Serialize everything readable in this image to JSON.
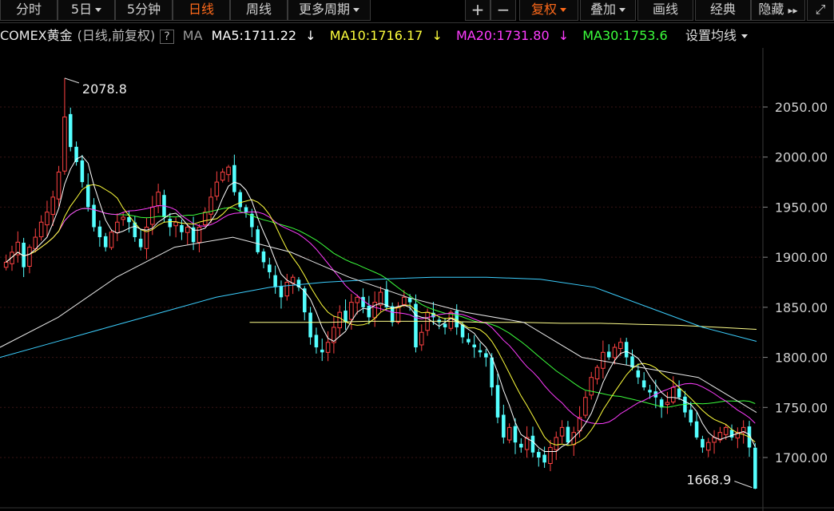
{
  "toolbar": {
    "tabs": [
      {
        "label": "分时"
      },
      {
        "label": "5日"
      },
      {
        "label": "5分钟"
      },
      {
        "label": "日线"
      },
      {
        "label": "周线"
      },
      {
        "label": "更多周期"
      }
    ],
    "right_buttons": [
      {
        "label": "+"
      },
      {
        "label": "−"
      },
      {
        "label": "复权"
      },
      {
        "label": "叠加"
      },
      {
        "label": "画线"
      },
      {
        "label": "经典"
      },
      {
        "label": "隐藏"
      }
    ],
    "active_tab": "日线"
  },
  "info": {
    "symbol": "COMEX黄金",
    "mode": "(日线,前复权)",
    "help": "?",
    "ma_label": "MA",
    "ma5": "MA5:1711.22",
    "ma10": "MA10:1716.17",
    "ma20": "MA20:1731.80",
    "ma30": "MA30:1753.6",
    "settings": "设置均线"
  },
  "colors": {
    "up": "#ff4242",
    "down": "#54ffff",
    "ma5": "#ffffff",
    "ma10": "#ffff3c",
    "ma20": "#ff3cff",
    "ma30": "#3cff3c",
    "ma60": "#e8e8e8",
    "ma120": "#3ccfff",
    "ma250": "#ffff8c",
    "active": "#ff6a1a"
  },
  "chart_data": {
    "type": "candlestick",
    "y_axis": {
      "ticks": [
        "2050.00",
        "2000.00",
        "1950.00",
        "1900.00",
        "1850.00",
        "1800.00",
        "1750.00",
        "1700.00"
      ],
      "range": [
        1665,
        2090
      ]
    },
    "annotations": {
      "high": "2078.8",
      "low": "1668.9"
    },
    "closes": [
      1895,
      1905,
      1915,
      1890,
      1910,
      1920,
      1935,
      1945,
      1960,
      1985,
      2040,
      2010,
      1995,
      1975,
      1950,
      1930,
      1920,
      1910,
      1925,
      1935,
      1940,
      1935,
      1920,
      1910,
      1930,
      1950,
      1965,
      1940,
      1930,
      1935,
      1925,
      1930,
      1915,
      1930,
      1945,
      1960,
      1975,
      1985,
      1990,
      1965,
      1950,
      1945,
      1930,
      1905,
      1895,
      1885,
      1870,
      1860,
      1875,
      1880,
      1870,
      1845,
      1820,
      1810,
      1805,
      1815,
      1830,
      1845,
      1835,
      1855,
      1860,
      1850,
      1840,
      1855,
      1865,
      1850,
      1835,
      1850,
      1860,
      1855,
      1810,
      1825,
      1845,
      1840,
      1835,
      1830,
      1845,
      1830,
      1820,
      1815,
      1810,
      1805,
      1800,
      1770,
      1740,
      1720,
      1730,
      1715,
      1710,
      1720,
      1705,
      1700,
      1695,
      1710,
      1720,
      1730,
      1715,
      1725,
      1740,
      1760,
      1780,
      1790,
      1805,
      1800,
      1810,
      1815,
      1800,
      1790,
      1780,
      1770,
      1765,
      1760,
      1750,
      1755,
      1770,
      1760,
      1745,
      1735,
      1720,
      1710,
      1715,
      1720,
      1725,
      1730,
      1720,
      1725,
      1730,
      1710,
      1669
    ],
    "ma_lines": [
      {
        "name": "MA250",
        "values": [
          1835,
          1835,
          1835,
          1836,
          1836,
          1836,
          1835,
          1835,
          1834,
          1834,
          1833,
          1832,
          1830,
          1828
        ]
      },
      {
        "name": "MA120",
        "values": [
          1800,
          1815,
          1830,
          1845,
          1860,
          1870,
          1875,
          1878,
          1880,
          1880,
          1878,
          1870,
          1850,
          1830,
          1816
        ]
      },
      {
        "name": "MA60",
        "values": [
          1810,
          1840,
          1880,
          1910,
          1920,
          1905,
          1880,
          1860,
          1845,
          1835,
          1800,
          1790,
          1780,
          1745
        ]
      }
    ]
  }
}
